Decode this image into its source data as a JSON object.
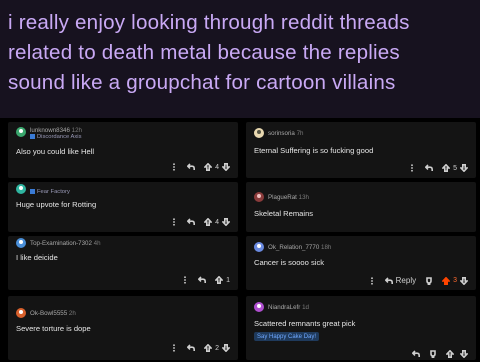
{
  "tweet": {
    "text_line1": "i really enjoy looking through reddit threads",
    "text_line2": "related to death metal because the replies",
    "text_line3": "sound like a groupchat for cartoon villains"
  },
  "comments": [
    {
      "username": "lunknown8346",
      "time": "12h",
      "flair": "Discordance Axis",
      "text": "Also you could like Hell",
      "votes": "4"
    },
    {
      "username": "sorinsoria",
      "time": "7h",
      "text": "Eternal Suffering is so fucking good",
      "votes": "5"
    },
    {
      "username": "",
      "flair": "Fear Factory",
      "text": "Huge upvote for Rotting",
      "votes": "4"
    },
    {
      "username": "PlagueRat",
      "time": "13h",
      "text": "Skeletal Remains",
      "votes": ""
    },
    {
      "username": "Top-Examination-7302",
      "time": "4h",
      "text": "I like deicide",
      "votes": "1"
    },
    {
      "username": "Ok_Relation_7770",
      "time": "18h",
      "text": "Cancer is soooo sick",
      "votes": "3",
      "reply_label": "Reply"
    },
    {
      "username": "Ok-Bowl5555",
      "time": "2h",
      "text": "Severe torture is dope",
      "votes": "2"
    },
    {
      "username": "NiandraLefr",
      "time": "1d",
      "text": "Scattered remnants great pick",
      "badge": "Say Happy Cake Day!",
      "votes": ""
    }
  ],
  "colors": {
    "accent_text": "#c9a9f5",
    "upvote": "#ff4500",
    "badge_text": "#6fa8ff"
  }
}
